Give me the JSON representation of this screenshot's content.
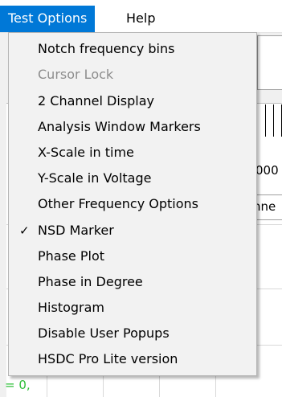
{
  "menubar": {
    "items": [
      {
        "label": "Test Options",
        "active": true
      },
      {
        "label": "Help",
        "active": false
      }
    ]
  },
  "dropdown": {
    "items": [
      {
        "label": "Notch frequency bins",
        "enabled": true,
        "checked": false
      },
      {
        "label": "Cursor Lock",
        "enabled": false,
        "checked": false
      },
      {
        "label": "2 Channel Display",
        "enabled": true,
        "checked": false
      },
      {
        "label": "Analysis Window Markers",
        "enabled": true,
        "checked": false
      },
      {
        "label": "X-Scale in time",
        "enabled": true,
        "checked": false
      },
      {
        "label": "Y-Scale in Voltage",
        "enabled": true,
        "checked": false
      },
      {
        "label": "Other Frequency Options",
        "enabled": true,
        "checked": false
      },
      {
        "label": "NSD Marker",
        "enabled": true,
        "checked": true,
        "check_mark": "✓"
      },
      {
        "label": "Phase Plot",
        "enabled": true,
        "checked": false
      },
      {
        "label": "Phase in Degree",
        "enabled": true,
        "checked": false
      },
      {
        "label": "Histogram",
        "enabled": true,
        "checked": false
      },
      {
        "label": "Disable User Popups",
        "enabled": true,
        "checked": false
      },
      {
        "label": "HSDC Pro Lite version",
        "enabled": true,
        "checked": false
      }
    ]
  },
  "background": {
    "axis_number_fragment": "000",
    "combo_fragment": "nne",
    "status_fragment": "= 0,"
  },
  "colors": {
    "menu_highlight": "#0078d7",
    "disabled_text": "#8d8d8d",
    "status_text": "#2fbf3a"
  }
}
